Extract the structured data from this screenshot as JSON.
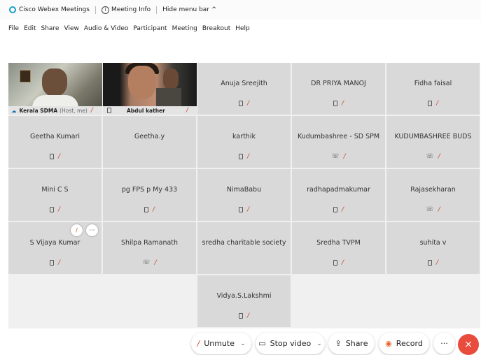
{
  "titlebar": {
    "app": "Cisco Webex Meetings",
    "meeting_info": "Meeting Info",
    "hide_menu": "Hide menu bar ^"
  },
  "menu": [
    "File",
    "Edit",
    "Share",
    "View",
    "Audio & Video",
    "Participant",
    "Meeting",
    "Breakout",
    "Help"
  ],
  "video_tiles": [
    {
      "name": "Kerala SDMA",
      "role": "(Host, me)"
    },
    {
      "name": "Abdul kather"
    }
  ],
  "participants": [
    "Anuja Sreejith",
    "DR PRIYA MANOJ",
    "Fidha faisal",
    "Geetha Kumari",
    "Geetha.y",
    "karthik",
    "Kudumbashree - SD SPM",
    "KUDUMBASHREE BUDS",
    "Mini C S",
    "pg FPS p My 433",
    "NimaBabu",
    "radhapadmakumar",
    "Rajasekharan",
    "S Vijaya Kumar",
    "Shilpa Ramanath",
    "sredha charitable society",
    "Sredha TVPM",
    "suhita v",
    "Vidya.S.Lakshmi"
  ],
  "toolbar": {
    "unmute": "Unmute",
    "stop_video": "Stop video",
    "share": "Share",
    "record": "Record",
    "more": "···",
    "leave": "×"
  },
  "colors": {
    "mic_muted": "#d0402c",
    "leave": "#e94b3c",
    "tile": "#d9d9d9"
  }
}
